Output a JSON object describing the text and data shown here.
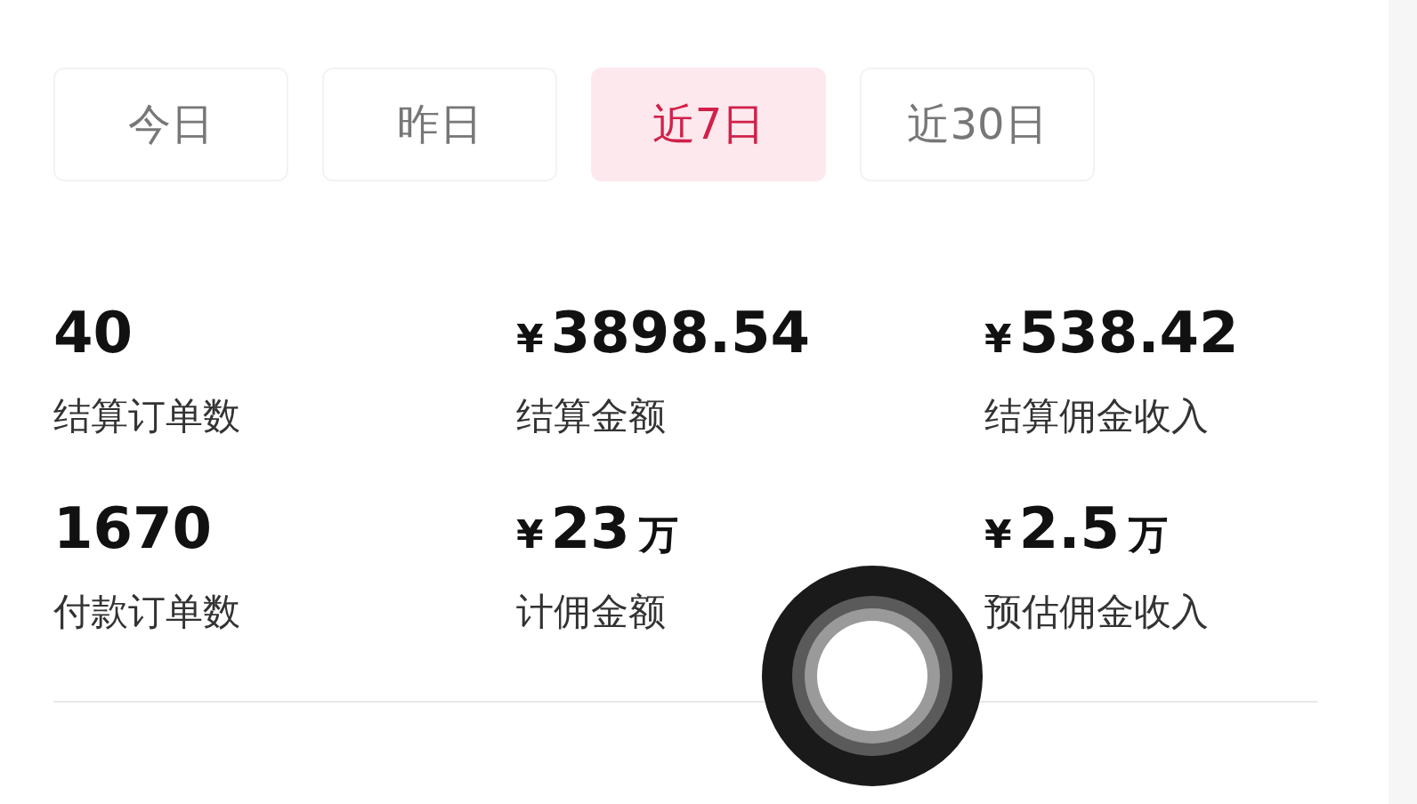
{
  "tabs": [
    {
      "label": "今日",
      "selected": false
    },
    {
      "label": "昨日",
      "selected": false
    },
    {
      "label": "近7日",
      "selected": true
    },
    {
      "label": "近30日",
      "selected": false
    }
  ],
  "stats": [
    {
      "value": "40",
      "label": "结算订单数"
    },
    {
      "currency": "¥",
      "value": "3898.54",
      "label": "结算金额"
    },
    {
      "currency": "¥",
      "value": "538.42",
      "label": "结算佣金收入"
    },
    {
      "value": "1670",
      "label": "付款订单数"
    },
    {
      "currency": "¥",
      "value": "23",
      "unit": "万",
      "label": "计佣金额"
    },
    {
      "currency": "¥",
      "value": "2.5",
      "unit": "万",
      "label": "预估佣金收入"
    }
  ]
}
